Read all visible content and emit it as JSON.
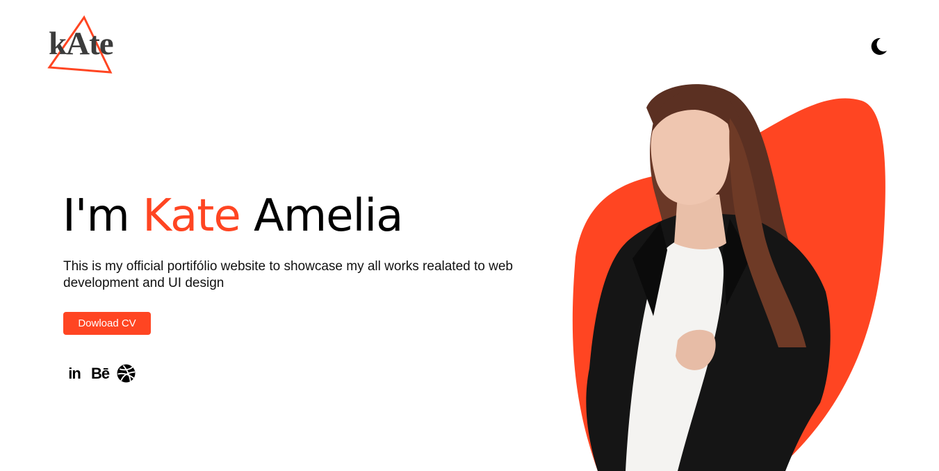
{
  "header": {
    "logo_text": "kAte",
    "theme_toggle_icon": "moon-icon"
  },
  "hero": {
    "greeting": "I'm",
    "first_name": "Kate",
    "last_name": "Amelia",
    "description": "This is my official portifólio website to showcase my all works realated to web development and UI design",
    "cta_label": "Dowload CV"
  },
  "socials": [
    {
      "name": "linkedin",
      "label": "in"
    },
    {
      "name": "behance",
      "label": "Bē"
    },
    {
      "name": "dribbble",
      "icon": "dribbble-icon"
    }
  ],
  "colors": {
    "accent": "#ff4522",
    "text": "#000000",
    "background": "#ffffff",
    "logo_text": "#3c3c3c"
  }
}
